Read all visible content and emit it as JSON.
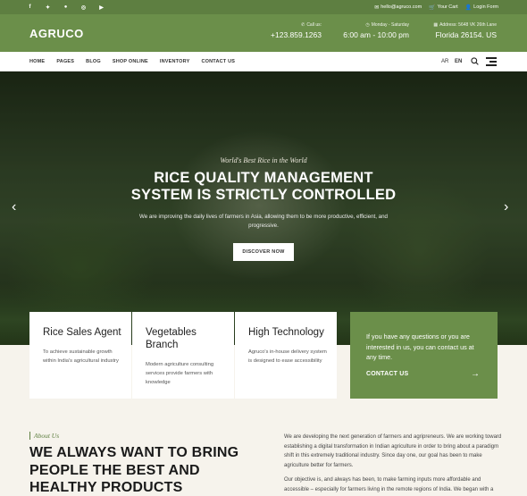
{
  "topbar": {
    "social_icons": [
      "facebook-icon",
      "twitter-icon",
      "github-icon",
      "dribbble-icon",
      "youtube-icon"
    ],
    "email": "hello@agruco.com",
    "cart": "Your Cart",
    "login": "Login Form"
  },
  "header": {
    "logo": "AGRUCO",
    "call_label": "Call us:",
    "call_value": "+123.859.1263",
    "hours_label": "Monday - Saturday",
    "hours_value": "6:00 am - 10:00 pm",
    "address_label": "Address: 5648 VK 26th Lane",
    "address_value": "Florida 26154. US"
  },
  "nav": {
    "items": [
      "HOME",
      "PAGES",
      "BLOG",
      "SHOP ONLINE",
      "INVENTORY",
      "CONTACT US"
    ],
    "lang_ar": "AR",
    "lang_en": "EN"
  },
  "hero": {
    "kicker": "World's Best Rice in the World",
    "title_line1": "RICE QUALITY MANAGEMENT",
    "title_line2": "SYSTEM IS STRICTLY CONTROLLED",
    "text": "We are improving the daily lives of farmers in Asia, allowing them to be more productive, efficient, and progressive.",
    "button": "DISCOVER NOW",
    "prev": "‹",
    "next": "›"
  },
  "features": [
    {
      "title": "Rice Sales Agent",
      "desc": "To achieve sustainable growth within India's agricultural industry"
    },
    {
      "title": "Vegetables Branch",
      "desc": "Modern agriculture consulting services provide farmers with knowledge"
    },
    {
      "title": "High Technology",
      "desc": "Agruco's in-house delivery system is designed to ease accessibility"
    }
  ],
  "cta": {
    "text": "If you have any questions or you are interested in us, you can contact us at any time.",
    "link": "CONTACT US",
    "arrow": "→"
  },
  "about": {
    "kicker": "About Us",
    "title": "WE ALWAYS WANT TO BRING PEOPLE THE BEST AND HEALTHY PRODUCTS",
    "p1": "We are developing the next generation of farmers and agripreneurs. We are working toward establishing a digital transformation in Indian agriculture in order to bring about a paradigm shift in this extremely traditional industry. Since day one, our goal has been to make agriculture better for farmers.",
    "p2": "Our objective is, and always has been, to make farming inputs more affordable and accessible – especially for farmers living in the remote regions of India. We began with a"
  },
  "colors": {
    "brand": "#6b8f4a",
    "brand_dark": "#5e7f41",
    "cream": "#f6f3ec"
  }
}
